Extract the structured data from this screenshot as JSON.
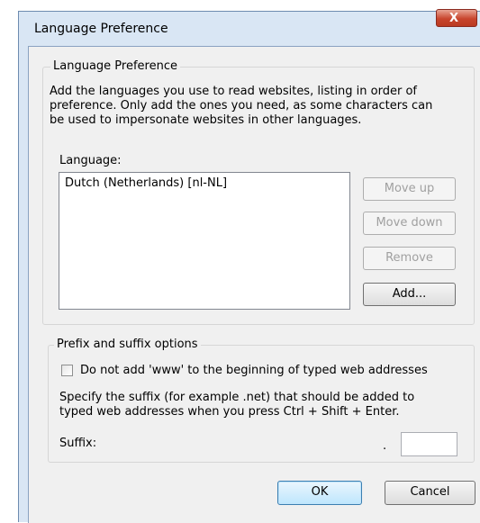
{
  "window": {
    "title": "Language Preference",
    "close_label": "X"
  },
  "language_group": {
    "legend": "Language Preference",
    "description_lines": [
      "Add the languages you use to read websites, listing in order of",
      "preference. Only add the ones you need, as some characters can",
      "be used to impersonate websites in other languages."
    ],
    "list_label": "Language:",
    "languages": [
      "Dutch (Netherlands) [nl-NL]"
    ],
    "buttons": {
      "move_up": "Move up",
      "move_down": "Move down",
      "remove": "Remove",
      "add": "Add..."
    }
  },
  "prefix_group": {
    "legend": "Prefix and suffix options",
    "checkbox_label": "Do not add 'www' to the beginning of typed web addresses",
    "checkbox_checked": false,
    "description_lines": [
      "Specify the suffix (for example .net) that should be added to",
      "typed web addresses when you press Ctrl + Shift + Enter."
    ],
    "suffix_label": "Suffix:",
    "suffix_dot": ".",
    "suffix_value": ""
  },
  "footer": {
    "ok_label": "OK",
    "cancel_label": "Cancel"
  }
}
